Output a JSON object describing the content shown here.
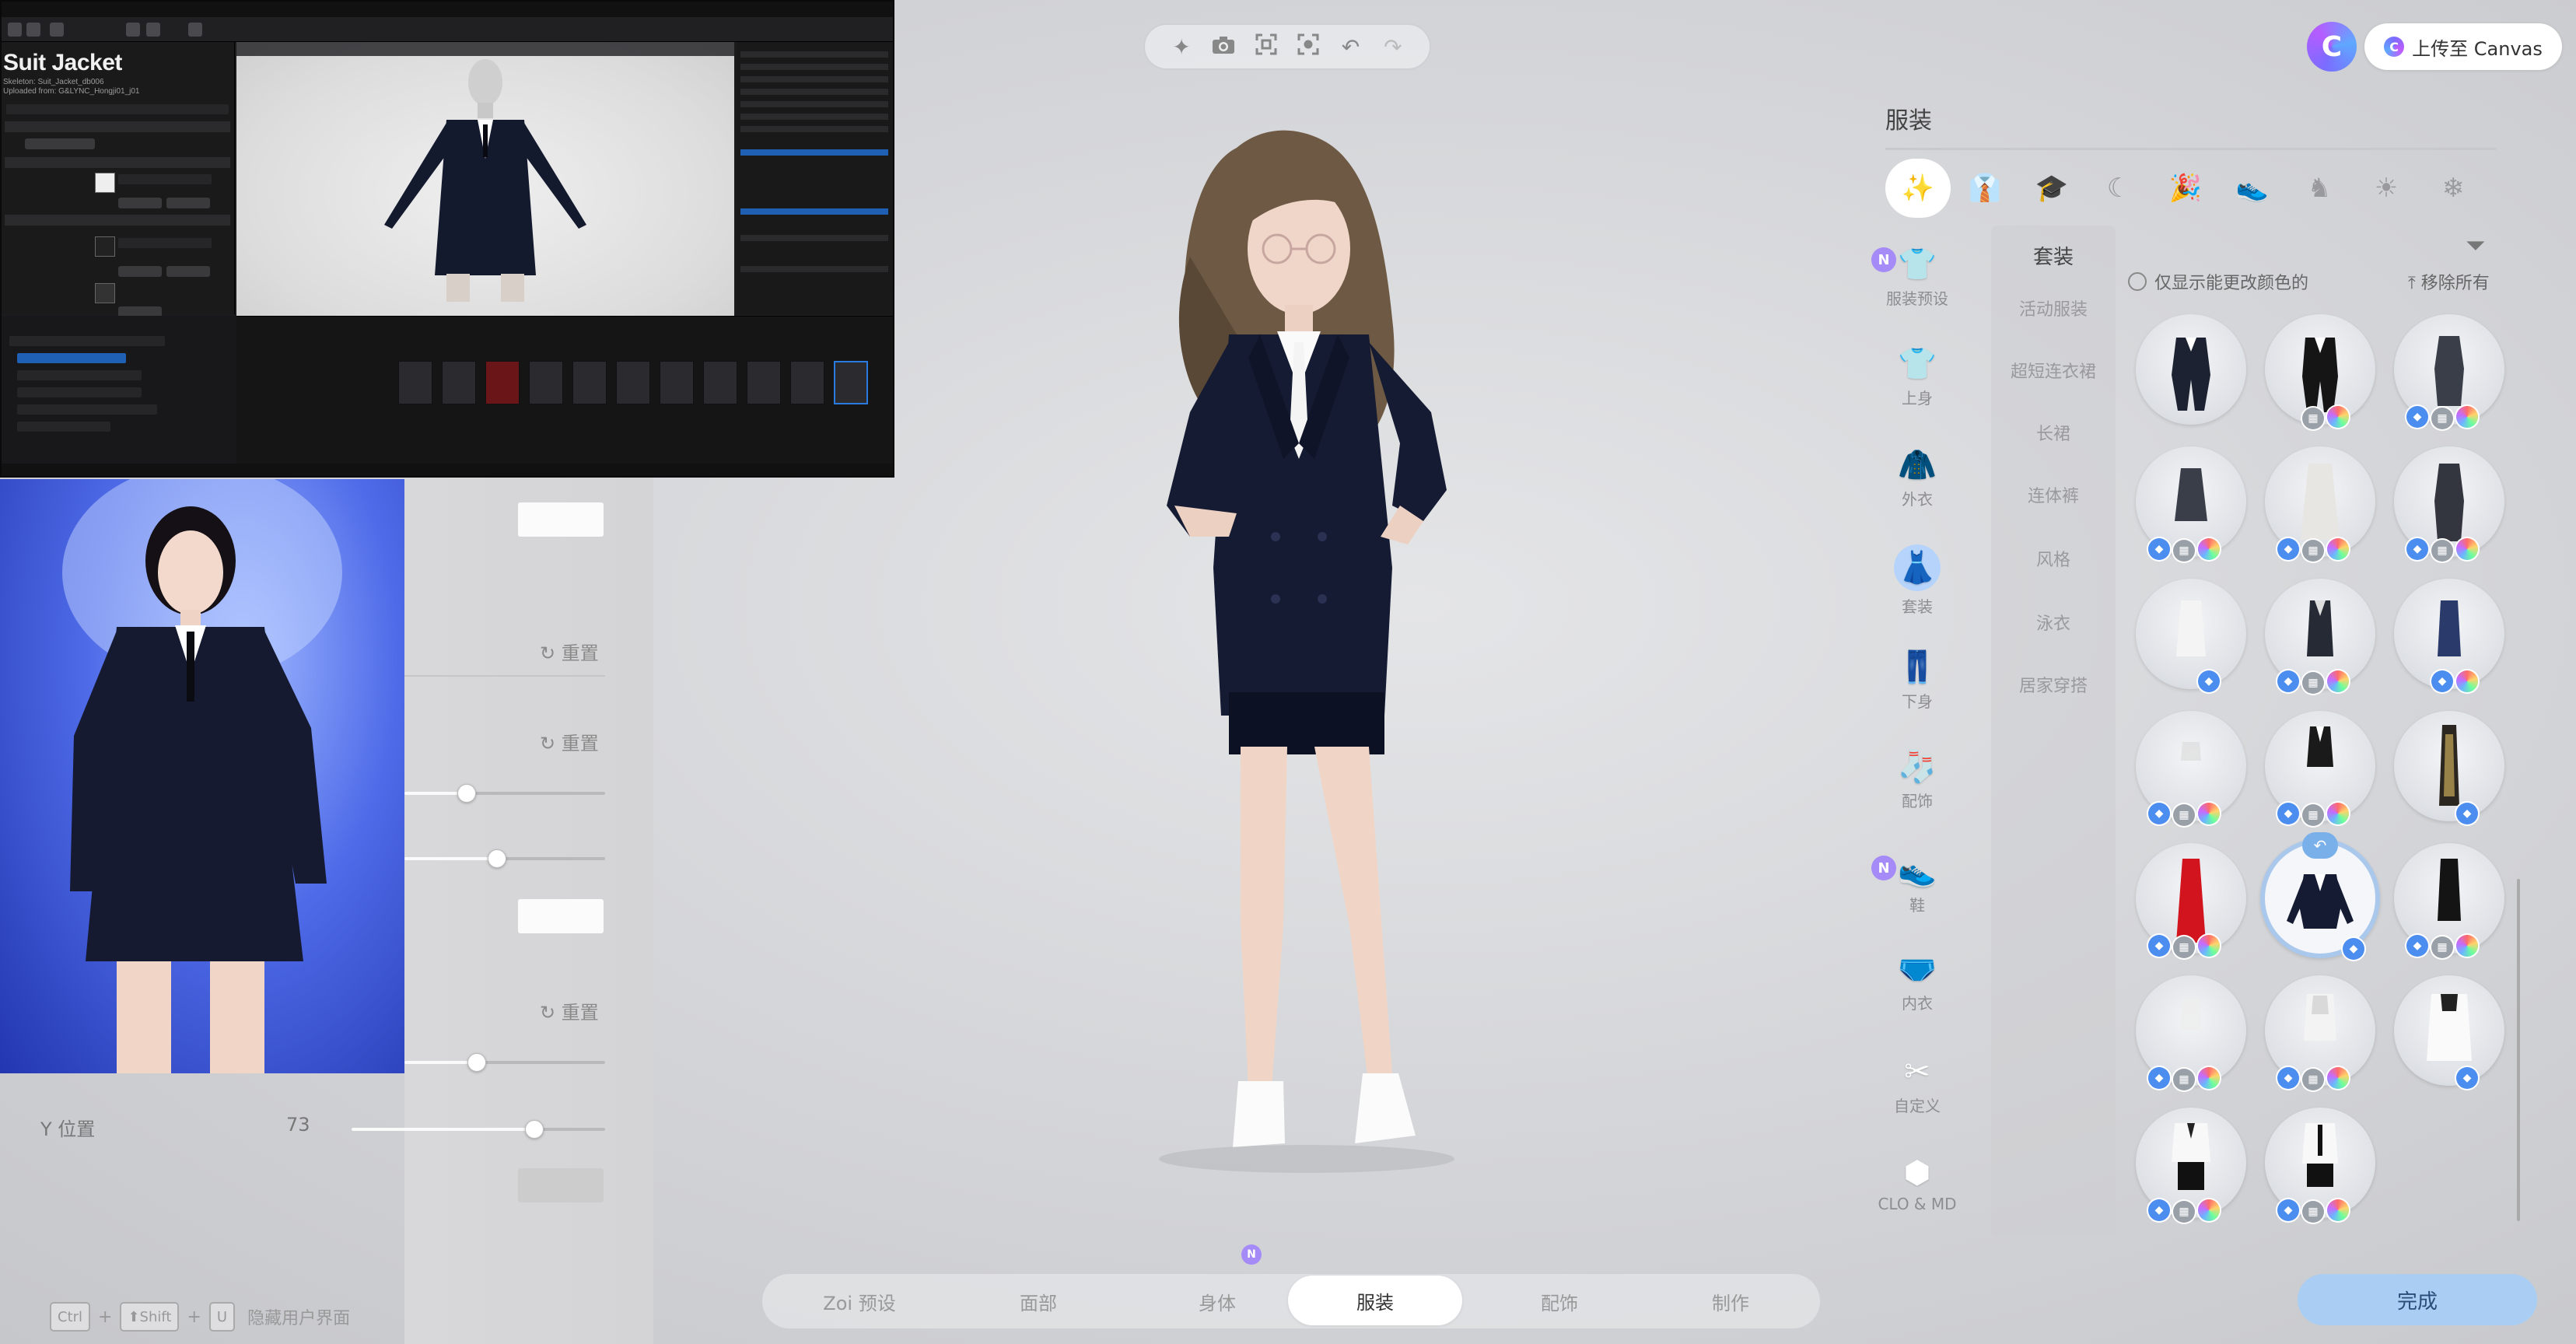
{
  "editor": {
    "asset_title": "Suit Jacket",
    "asset_sub_1": "Skeleton: Suit_Jacket_db006",
    "asset_sub_2": "Uploaded from: G&LYNC_Hongji01_j01"
  },
  "settings": {
    "reset_label": "重置",
    "ypos_label": "Y 位置",
    "ypos_value": "73",
    "sliders": [
      0.31,
      0.46,
      0.36,
      0.72
    ],
    "shortcut": {
      "keys": [
        "Ctrl",
        "⬆Shift",
        "U"
      ],
      "plus": "+",
      "label": "隐藏用户界面"
    }
  },
  "top_toolbar": {
    "icons": [
      "sparkle-icon",
      "camera-icon",
      "frame-icon",
      "focus-icon",
      "undo-icon",
      "redo-icon"
    ]
  },
  "bottom_tabs": [
    {
      "label": "Zoi 预设",
      "active": false
    },
    {
      "label": "面部",
      "active": false
    },
    {
      "label": "身体",
      "active": false
    },
    {
      "label": "服装",
      "active": true
    },
    {
      "label": "配饰",
      "active": false
    },
    {
      "label": "制作",
      "active": false
    }
  ],
  "top_right": {
    "avatar_letter": "C",
    "upload_label": "上传至 Canvas",
    "upload_icon_letter": "C"
  },
  "panel": {
    "title": "服装",
    "only_color_label": "仅显示能更改颜色的",
    "remove_all_label": "移除所有",
    "done_label": "完成"
  },
  "side_categories": [
    {
      "label": "服装预设",
      "icon": "outfit-preset-icon",
      "badge": "N",
      "active": false
    },
    {
      "label": "上身",
      "icon": "tshirt-icon",
      "badge": "",
      "active": false
    },
    {
      "label": "外衣",
      "icon": "coat-icon",
      "badge": "",
      "active": false
    },
    {
      "label": "套装",
      "icon": "dress-icon",
      "badge": "",
      "active": true
    },
    {
      "label": "下身",
      "icon": "pants-icon",
      "badge": "",
      "active": false
    },
    {
      "label": "配饰",
      "icon": "sock-icon",
      "badge": "",
      "active": false
    },
    {
      "label": "鞋",
      "icon": "shoe-icon",
      "badge": "N",
      "active": false
    },
    {
      "label": "内衣",
      "icon": "underwear-icon",
      "badge": "",
      "active": false
    },
    {
      "label": "自定义",
      "icon": "scissors-icon",
      "badge": "",
      "active": false
    },
    {
      "label": "CLO & MD",
      "icon": "clo-md-icon",
      "badge": "",
      "active": false
    }
  ],
  "subcategories": {
    "head": "套装",
    "items": [
      "活动服装",
      "超短连衣裙",
      "长裙",
      "连体裤",
      "风格",
      "泳衣",
      "居家穿搭"
    ]
  },
  "badges": {
    "new": "N"
  },
  "colors": {
    "accent": "#a9cdf3",
    "active_tab_icon": "#8ab7ef",
    "badge_new": "#a58bf7"
  }
}
